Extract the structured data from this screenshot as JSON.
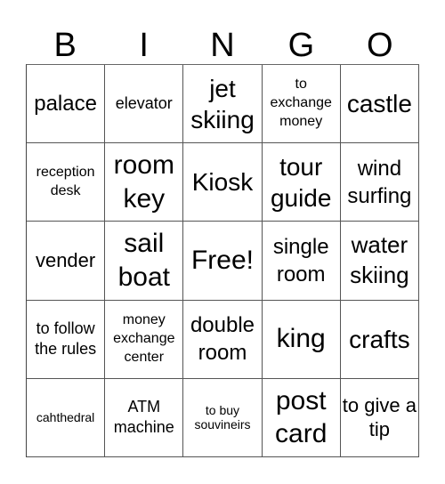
{
  "header": [
    "B",
    "I",
    "N",
    "G",
    "O"
  ],
  "cells": [
    {
      "text": "palace",
      "size": "s24"
    },
    {
      "text": "elevator",
      "size": "s18"
    },
    {
      "text": "jet skiing",
      "size": "s28"
    },
    {
      "text": "to exchange money",
      "size": "s16"
    },
    {
      "text": "castle",
      "size": "s28"
    },
    {
      "text": "reception desk",
      "size": "s16"
    },
    {
      "text": "room key",
      "size": "s30"
    },
    {
      "text": "Kiosk",
      "size": "s28"
    },
    {
      "text": "tour guide",
      "size": "s28"
    },
    {
      "text": "wind surfing",
      "size": "s24"
    },
    {
      "text": "vender",
      "size": "s22"
    },
    {
      "text": "sail boat",
      "size": "s30"
    },
    {
      "text": "Free!",
      "size": "s30"
    },
    {
      "text": "single room",
      "size": "s24"
    },
    {
      "text": "water skiing",
      "size": "s26"
    },
    {
      "text": "to follow the rules",
      "size": "s18"
    },
    {
      "text": "money exchange center",
      "size": "s16"
    },
    {
      "text": "double room",
      "size": "s24"
    },
    {
      "text": "king",
      "size": "s30"
    },
    {
      "text": "crafts",
      "size": "s28"
    },
    {
      "text": "cahthedral",
      "size": "s14"
    },
    {
      "text": "ATM machine",
      "size": "s18"
    },
    {
      "text": "to buy souvineirs",
      "size": "s14"
    },
    {
      "text": "post card",
      "size": "s30"
    },
    {
      "text": "to give a tip",
      "size": "s22"
    }
  ]
}
